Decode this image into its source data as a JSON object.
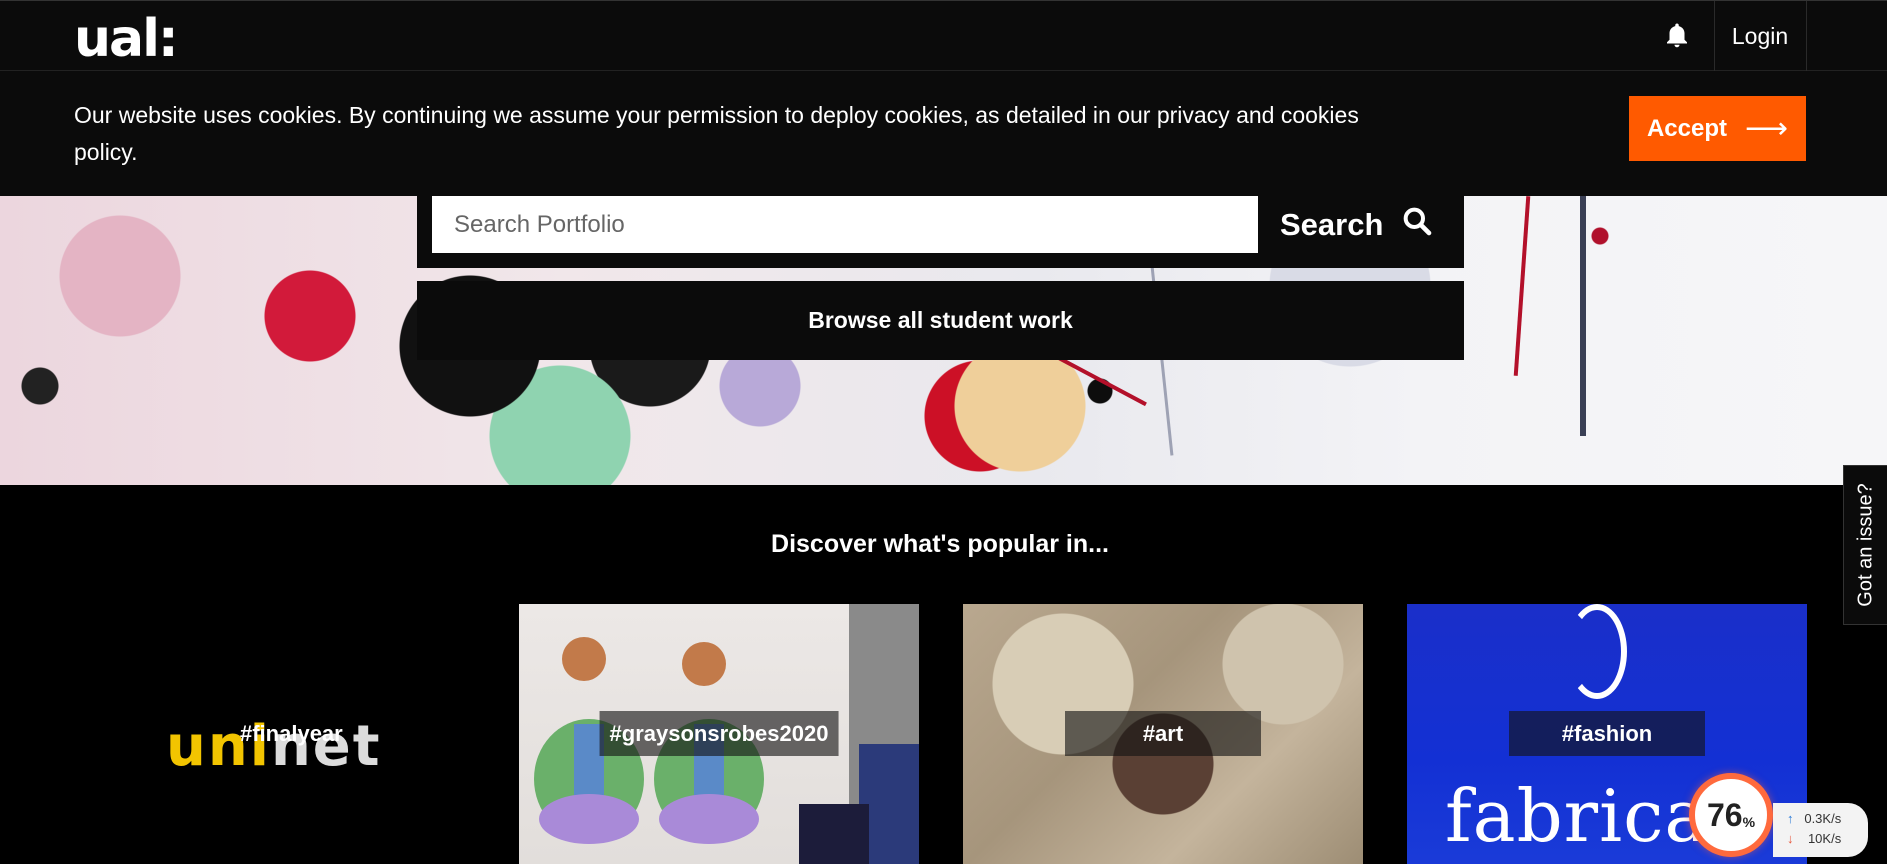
{
  "header": {
    "logo": "ual:",
    "login_label": "Login",
    "notification_icon": "bell-icon"
  },
  "cookie_banner": {
    "text": "Our website uses cookies. By continuing we assume your permission to deploy cookies, as detailed in our privacy and cookies policy.",
    "accept_label": "Accept",
    "accept_color": "#ff5a00"
  },
  "search": {
    "placeholder": "Search Portfolio",
    "button_label": "Search",
    "browse_label": "Browse all student work"
  },
  "discover": {
    "title": "Discover what's popular in...",
    "cards": [
      {
        "tag": "#finalyear",
        "logo_a": "uni",
        "logo_b": "net"
      },
      {
        "tag": "#graysonsrobes2020"
      },
      {
        "tag": "#art"
      },
      {
        "tag": "#fashion",
        "logo_text": "fabricat"
      }
    ]
  },
  "issue_tab": {
    "label": "Got an issue?"
  },
  "speed_widget": {
    "percent": "76",
    "percent_unit": "%",
    "upload": "0.3",
    "download": "10",
    "rate_unit": "K/s"
  }
}
